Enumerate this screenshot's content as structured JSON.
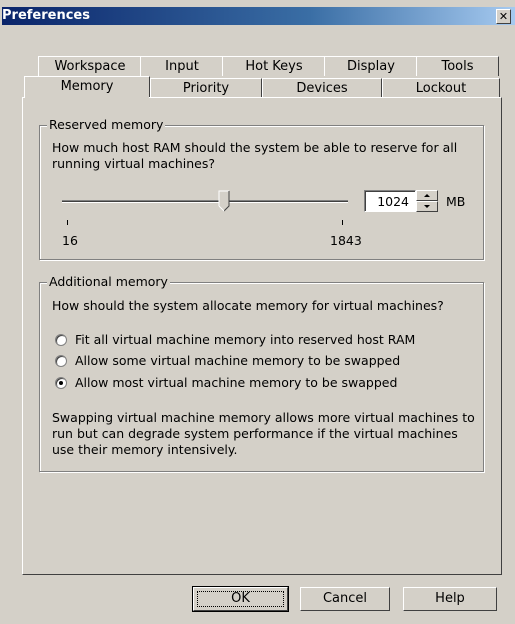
{
  "window": {
    "title": "Preferences",
    "close_glyph": "✕"
  },
  "tabs": {
    "row1": [
      "Workspace",
      "Input",
      "Hot Keys",
      "Display",
      "Tools"
    ],
    "row2": [
      "Memory",
      "Priority",
      "Devices",
      "Lockout"
    ],
    "active": "Memory"
  },
  "reserved": {
    "label": "Reserved memory",
    "question": "How much host RAM should the system be able to reserve for all running virtual machines?",
    "min_label": "16",
    "max_label": "1843",
    "value": "1024",
    "unit": "MB",
    "slider_fraction": 0.57
  },
  "additional": {
    "label": "Additional memory",
    "question": "How should the system allocate memory for virtual machines?",
    "options": [
      "Fit all virtual machine memory into reserved host RAM",
      "Allow some virtual machine memory to be swapped",
      "Allow most virtual machine memory to be swapped"
    ],
    "selected_index": 2,
    "note": "Swapping virtual machine memory allows more virtual machines to run but can degrade system performance if the virtual machines use their memory intensively."
  },
  "buttons": {
    "ok": "OK",
    "cancel": "Cancel",
    "help": "Help"
  }
}
